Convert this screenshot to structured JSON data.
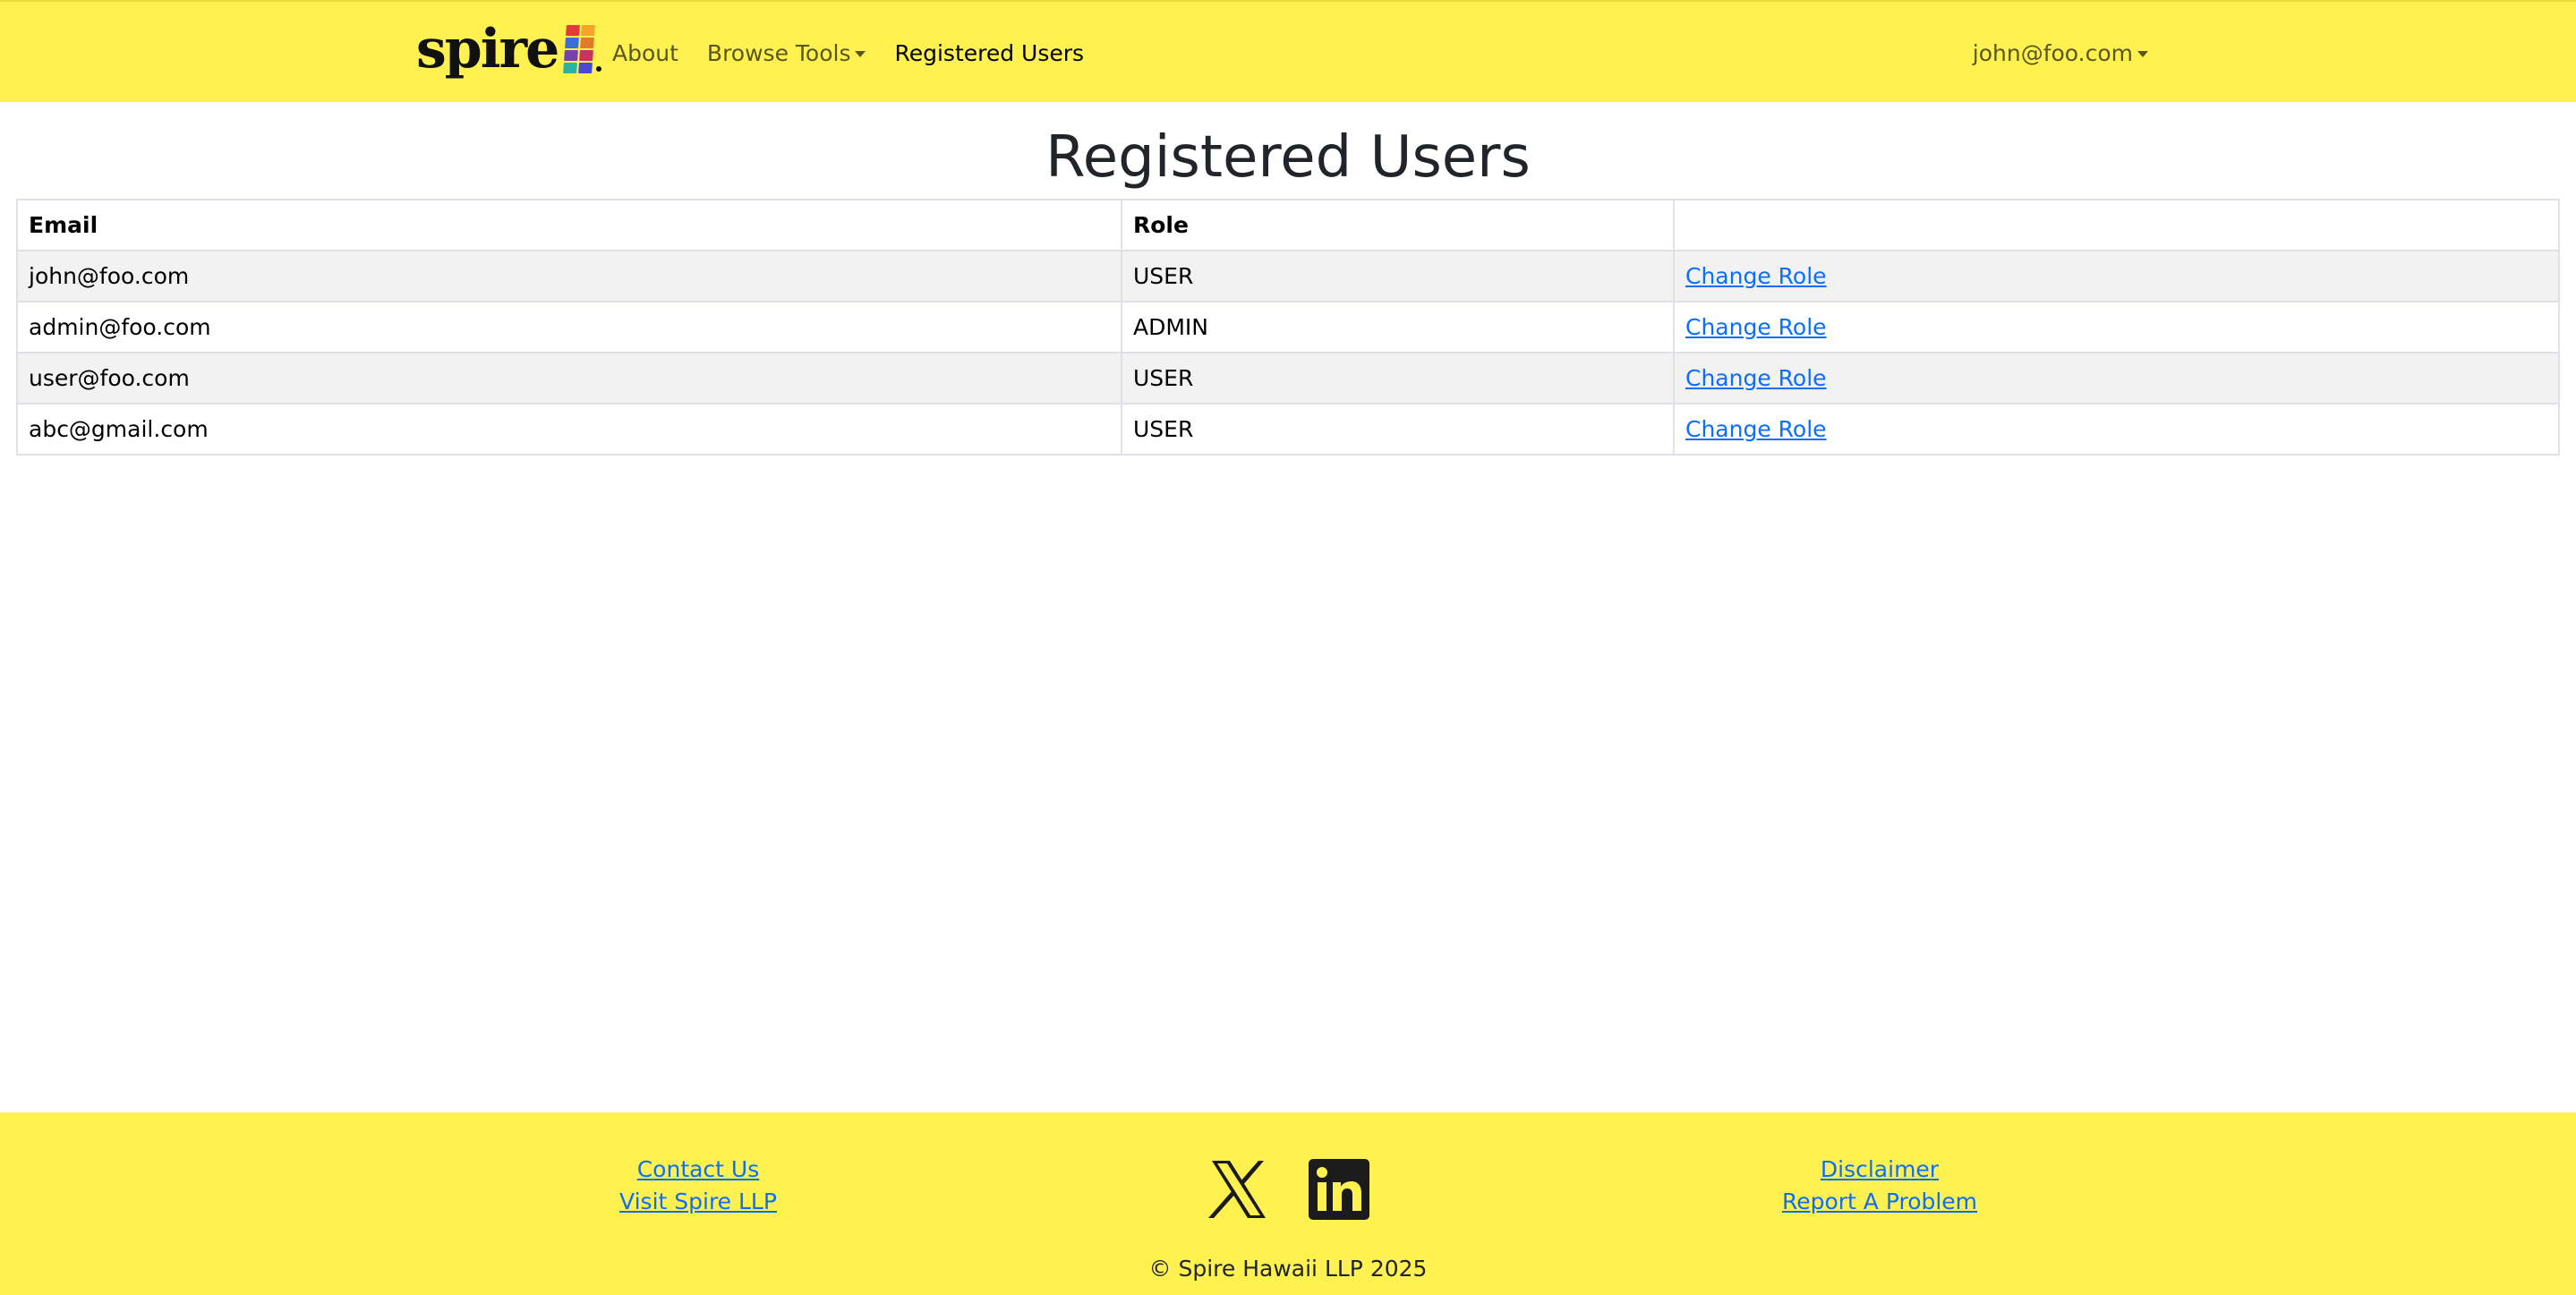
{
  "brand": {
    "name": "spire",
    "colors": [
      "#e23b3b",
      "#f3a42a",
      "#3a6fd8",
      "#7b3fa8",
      "#2bb3a3",
      "#e07b2a",
      "#4a4ad0",
      "#c8325b"
    ]
  },
  "nav": {
    "about": "About",
    "browse_tools": "Browse Tools",
    "registered_users": "Registered Users",
    "user_email": "john@foo.com"
  },
  "page": {
    "title": "Registered Users"
  },
  "table": {
    "headers": [
      "Email",
      "Role",
      ""
    ],
    "rows": [
      {
        "email": "john@foo.com",
        "role": "USER",
        "action": "Change Role"
      },
      {
        "email": "admin@foo.com",
        "role": "ADMIN",
        "action": "Change Role"
      },
      {
        "email": "user@foo.com",
        "role": "USER",
        "action": "Change Role"
      },
      {
        "email": "abc@gmail.com",
        "role": "USER",
        "action": "Change Role"
      }
    ]
  },
  "footer": {
    "contact_us": "Contact Us",
    "visit_spire": "Visit Spire LLP",
    "disclaimer": "Disclaimer",
    "report_problem": "Report A Problem",
    "copyright": "© Spire Hawaii LLP 2025",
    "social_icons": [
      "x-logo-icon",
      "linkedin-icon"
    ]
  },
  "colors": {
    "navbar_bg": "#fff250",
    "link": "#0d6efd",
    "stripe": "#f2f2f2"
  }
}
